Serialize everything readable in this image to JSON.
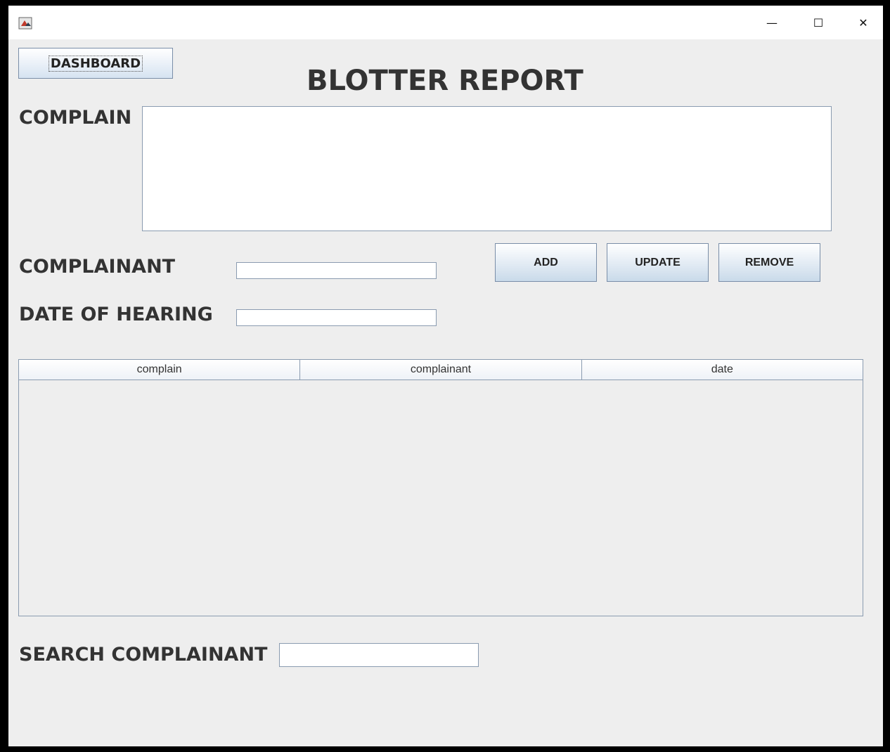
{
  "window": {
    "controls": {
      "minimize": "—",
      "maximize": "☐",
      "close": "✕"
    }
  },
  "dashboard_button": {
    "label": "DASHBOARD"
  },
  "page_title": "BLOTTER REPORT",
  "form": {
    "complain_label": "COMPLAIN",
    "complain_value": "",
    "complainant_label": "COMPLAINANT",
    "complainant_value": "",
    "date_label": "DATE OF HEARING",
    "date_value": ""
  },
  "actions": {
    "add": "ADD",
    "update": "UPDATE",
    "remove": "REMOVE"
  },
  "table": {
    "columns": [
      "complain",
      "complainant",
      "date"
    ],
    "rows": []
  },
  "search": {
    "label": "SEARCH COMPLAINANT",
    "value": ""
  },
  "icons": {
    "app": "java-app-icon",
    "minimize": "minimize-icon",
    "maximize": "maximize-icon",
    "close": "close-icon"
  }
}
